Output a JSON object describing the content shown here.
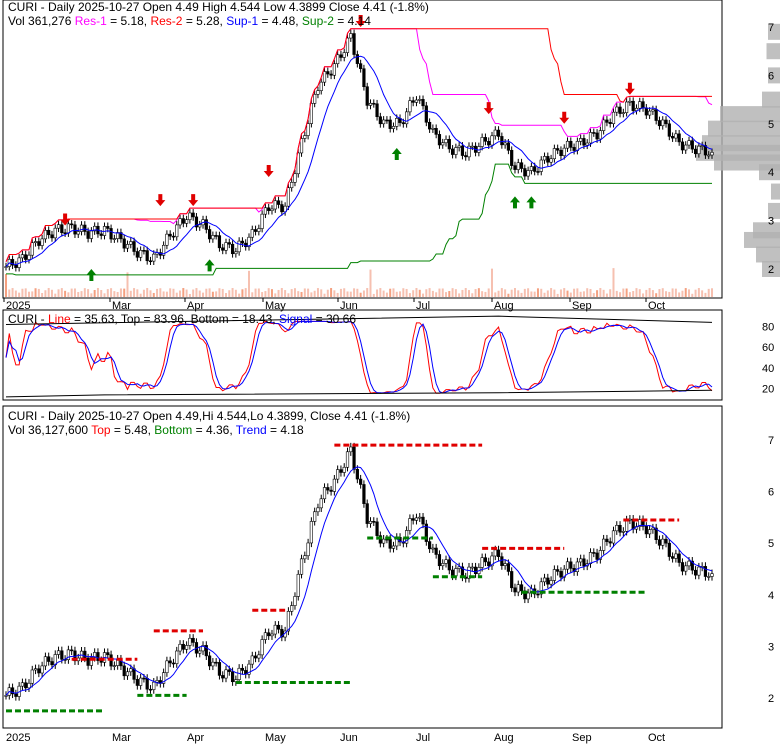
{
  "chart_data": [
    {
      "type": "candlestick",
      "panel": "price-main",
      "title": "CURI - Daily 2025-10-27 Open 4.49  High 4.544  Low 4.3899  Close 4.41 (-1.8%)",
      "legend": {
        "vol": "Vol 361,276",
        "res1_label": "Res-1",
        "res1_val": " = 5.18, ",
        "res2_label": "Res-2",
        "res2_val": " = 5.28, ",
        "sup1_label": "Sup-1",
        "sup1_val": " = 4.48, ",
        "sup2_label": "Sup-2",
        "sup2_val": " = 4.14"
      },
      "ylim": [
        1.8,
        7.5
      ],
      "yticks": [
        2,
        3,
        4,
        5,
        6,
        7
      ],
      "colors": {
        "res1": "#ff00ff",
        "res2": "#ff0000",
        "sup1": "#0000ff",
        "sup2": "#008000"
      }
    },
    {
      "type": "line",
      "panel": "stochastic",
      "title_prefix": "CURI - ",
      "line_label": "Line",
      "line_val": " = 35.63, Top = 83.96, Bottom = 18.43, ",
      "signal_label": "Signal",
      "signal_val": " = 30.66",
      "ylim": [
        10,
        95
      ],
      "yticks": [
        20,
        40,
        60,
        80
      ]
    },
    {
      "type": "candlestick",
      "panel": "price-trend",
      "title": "CURI - Daily 2025-10-27 Open 4.49,Hi 4.544,Lo 4.3899, Close 4.41 (-1.8%)",
      "legend": {
        "vol": "Vol 36,127,600 ",
        "top_label": "Top",
        "top_val": " = 5.48, ",
        "bottom_label": "Bottom",
        "bottom_val": " = 4.36, ",
        "trend_label": "Trend",
        "trend_val": " = 4.18"
      },
      "ylim": [
        1.6,
        7.5
      ],
      "yticks": [
        2,
        3,
        4,
        5,
        6,
        7
      ]
    }
  ],
  "x_labels": [
    "2025",
    "Mar",
    "Apr",
    "May",
    "Jun",
    "Jul",
    "Aug",
    "Sep",
    "Oct"
  ],
  "weekly_closes": [
    2.05,
    2.2,
    2.6,
    2.8,
    2.85,
    2.75,
    2.8,
    2.6,
    2.35,
    2.2,
    2.7,
    3.1,
    2.9,
    2.5,
    2.4,
    2.7,
    3.3,
    3.3,
    4.6,
    5.8,
    6.2,
    6.8,
    5.5,
    5.0,
    5.0,
    5.6,
    4.8,
    4.5,
    4.4,
    4.6,
    4.8,
    4.1,
    4.0,
    4.3,
    4.5,
    4.6,
    4.8,
    5.2,
    5.4,
    5.3,
    5.0,
    4.6,
    4.49,
    4.41
  ]
}
